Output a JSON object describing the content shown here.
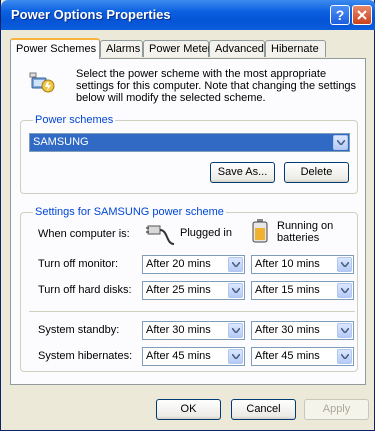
{
  "window": {
    "title": "Power Options Properties"
  },
  "tabs": [
    {
      "label": "Power Schemes"
    },
    {
      "label": "Alarms"
    },
    {
      "label": "Power Meter"
    },
    {
      "label": "Advanced"
    },
    {
      "label": "Hibernate"
    }
  ],
  "intro": {
    "text": "Select the power scheme with the most appropriate settings for this computer. Note that changing the settings below will modify the selected scheme."
  },
  "schemes": {
    "legend": "Power schemes",
    "selected": "SAMSUNG",
    "save_as_label": "Save As...",
    "delete_label": "Delete"
  },
  "settings": {
    "legend": "Settings for SAMSUNG power scheme",
    "when_label": "When computer is:",
    "plugged_label": "Plugged in",
    "battery_label": "Running on batteries",
    "rows": [
      {
        "label": "Turn off monitor:",
        "plugged": "After 20 mins",
        "battery": "After 10 mins"
      },
      {
        "label": "Turn off hard disks:",
        "plugged": "After 25 mins",
        "battery": "After 15 mins"
      },
      {
        "label": "System standby:",
        "plugged": "After 30 mins",
        "battery": "After 30 mins"
      },
      {
        "label": "System hibernates:",
        "plugged": "After 45 mins",
        "battery": "After 45 mins"
      }
    ]
  },
  "footer": {
    "ok_label": "OK",
    "cancel_label": "Cancel",
    "apply_label": "Apply"
  },
  "icons": {
    "help": "help-icon",
    "close": "close-icon",
    "intro": "power-scheme-icon",
    "plug": "plug-icon",
    "battery": "battery-icon",
    "dropdown": "chevron-down-icon"
  }
}
